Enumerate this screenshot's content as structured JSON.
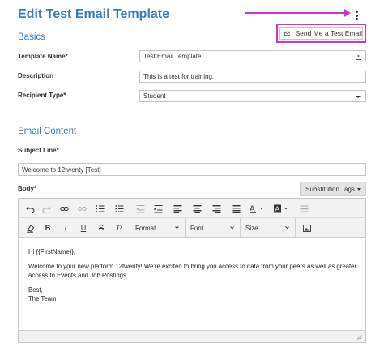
{
  "page": {
    "title": "Edit Test Email Template",
    "test_email_button": "Send Me a Test Email"
  },
  "basics": {
    "heading": "Basics",
    "template_name_label": "Template Name*",
    "template_name_value": "Test Email Template",
    "description_label": "Description",
    "description_value": "This is a test for training.",
    "recipient_type_label": "Recipient Type*",
    "recipient_type_value": "Student"
  },
  "email_content": {
    "heading": "Email Content",
    "subject_label": "Subject Line*",
    "subject_value": "Welcome to 12twenty [Test]",
    "body_label": "Body*",
    "substitution_tags_label": "Substitution Tags"
  },
  "toolbar": {
    "format_label": "Format",
    "font_label": "Font",
    "size_label": "Size"
  },
  "body_content": {
    "greeting": "Hi {{FirstName}},",
    "paragraph": "Welcome to your new platform 12twenty! We're excited to bring you access to data from your peers as well as greater access to Events and Job Postings.",
    "closing": "Best,",
    "signature": "The Team"
  },
  "colors": {
    "accent": "#3a7bbf",
    "annotation": "#d630c7"
  }
}
